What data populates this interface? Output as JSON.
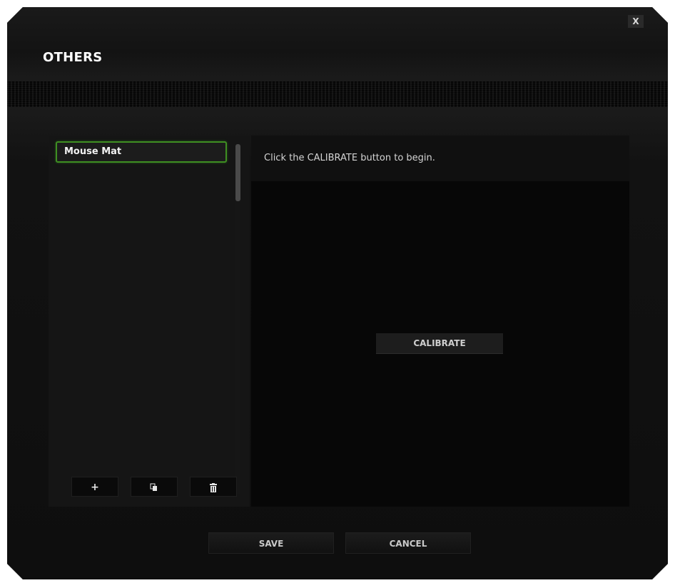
{
  "window": {
    "title": "OTHERS",
    "close_label": "X"
  },
  "profiles": {
    "items": [
      {
        "label": "Mouse Mat",
        "selected": true
      }
    ],
    "buttons": {
      "add_label": "+",
      "copy_icon": "copy-icon",
      "delete_icon": "trash-icon"
    }
  },
  "calibration": {
    "instruction": "Click the CALIBRATE button to begin.",
    "calibrate_label": "CALIBRATE"
  },
  "footer": {
    "save_label": "SAVE",
    "cancel_label": "CANCEL"
  },
  "colors": {
    "accent_green": "#44d62c",
    "background": "#0b0b0b"
  }
}
